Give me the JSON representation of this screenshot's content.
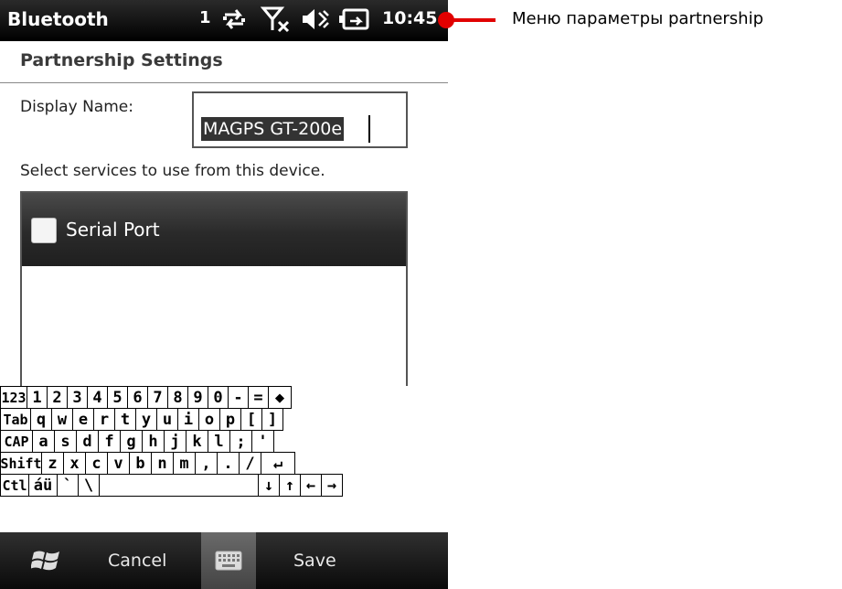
{
  "status_bar": {
    "title": "Bluetooth",
    "signal_number": "1",
    "time": "10:45",
    "icons": [
      "sync-arrows-icon",
      "no-signal-icon",
      "speaker-muted-icon",
      "battery-charging-icon"
    ]
  },
  "header": {
    "title": "Partnership Settings"
  },
  "form": {
    "display_name_label": "Display Name:",
    "display_name_value": "MAGPS GT-200e",
    "services_label": "Select services to use from this device.",
    "services": [
      {
        "label": "Serial Port",
        "checked": false
      }
    ]
  },
  "keyboard": {
    "rows": [
      [
        "123",
        "1",
        "2",
        "3",
        "4",
        "5",
        "6",
        "7",
        "8",
        "9",
        "0",
        "-",
        "=",
        "◆"
      ],
      [
        "Tab",
        "q",
        "w",
        "e",
        "r",
        "t",
        "y",
        "u",
        "i",
        "o",
        "p",
        "[",
        "]"
      ],
      [
        "CAP",
        "a",
        "s",
        "d",
        "f",
        "g",
        "h",
        "j",
        "k",
        "l",
        ";",
        "'"
      ],
      [
        "Shift",
        "z",
        "x",
        "c",
        "v",
        "b",
        "n",
        "m",
        ",",
        ".",
        "/",
        "↵"
      ],
      [
        "Ctl",
        "áü",
        "`",
        "\\",
        "",
        "↓",
        "↑",
        "←",
        "→"
      ]
    ]
  },
  "bottom_bar": {
    "left_label": "Cancel",
    "right_label": "Save"
  },
  "annotation": {
    "text": "Меню параметры partnership",
    "color": "#e10000"
  }
}
